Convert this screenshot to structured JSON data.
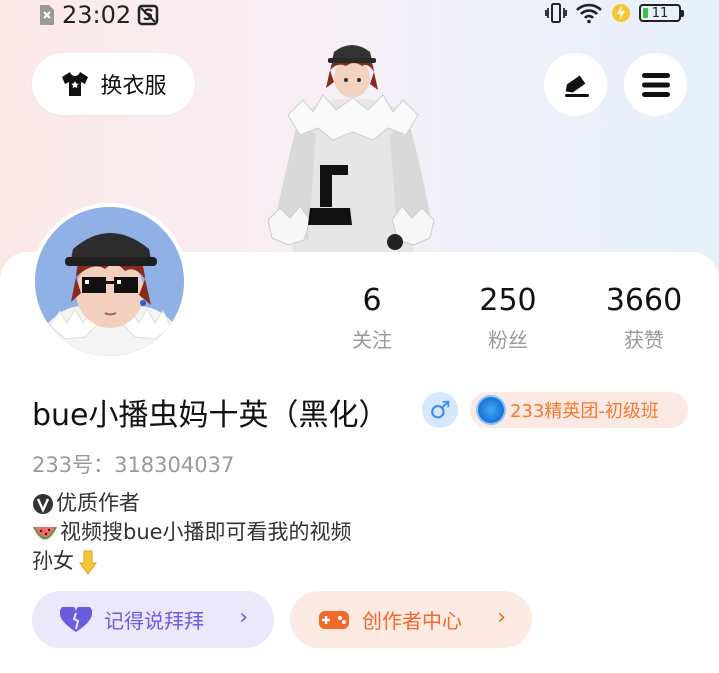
{
  "status_bar": {
    "time": "23:02",
    "battery_level": "11"
  },
  "header": {
    "dress_button_label": "换衣服"
  },
  "stats": [
    {
      "value": "6",
      "label": "关注"
    },
    {
      "value": "250",
      "label": "粉丝"
    },
    {
      "value": "3660",
      "label": "获赞"
    }
  ],
  "profile": {
    "name": "bue小播虫妈十英（黑化）",
    "gender_symbol": "♂",
    "badge_label": "233精英团-初级班",
    "uid": "233号：318304037",
    "bio": [
      {
        "icon": "verified-v-icon",
        "text": "优质作者"
      },
      {
        "icon": "watermelon-icon",
        "text": "视频搜bue小播即可看我的视频"
      },
      {
        "icon": "pointing-down-icon",
        "text": "孙女"
      }
    ]
  },
  "actions": {
    "left_label": "记得说拜拜",
    "right_label": "创作者中心"
  },
  "colors": {
    "left_pill_bg": "#ebe8fb",
    "left_pill_fg": "#6c5de0",
    "right_pill_bg": "#fdeae3",
    "right_pill_fg": "#f26a2a"
  }
}
